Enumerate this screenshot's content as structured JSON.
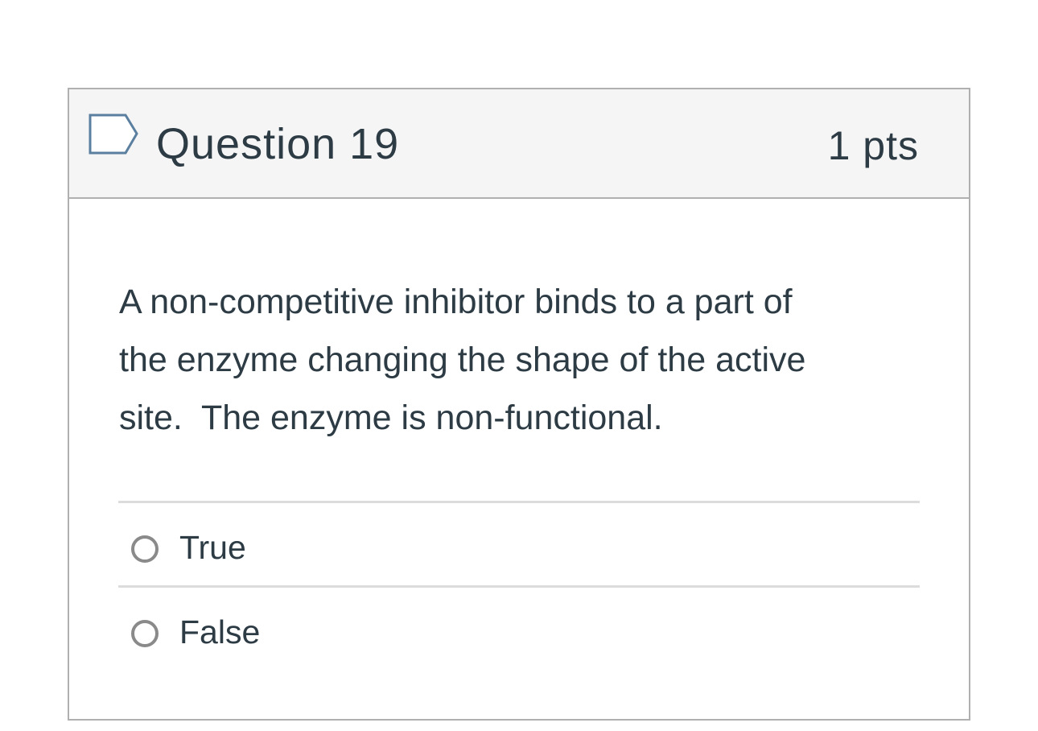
{
  "question": {
    "title": "Question 19",
    "points": "1 pts",
    "flag_icon": "flag-icon",
    "text": "A non-competitive inhibitor binds to a part of\nthe enzyme changing the shape of the active\nsite.  The enzyme is non-functional.",
    "answers": [
      {
        "label": "True",
        "selected": false
      },
      {
        "label": "False",
        "selected": false
      }
    ]
  },
  "colors": {
    "header_background": "#f5f5f5",
    "border": "#b0b0b0",
    "text": "#2d3b45",
    "flag_outline": "#5b7f9f",
    "radio_border": "#8a8a8a",
    "divider": "#dcdcdc"
  }
}
